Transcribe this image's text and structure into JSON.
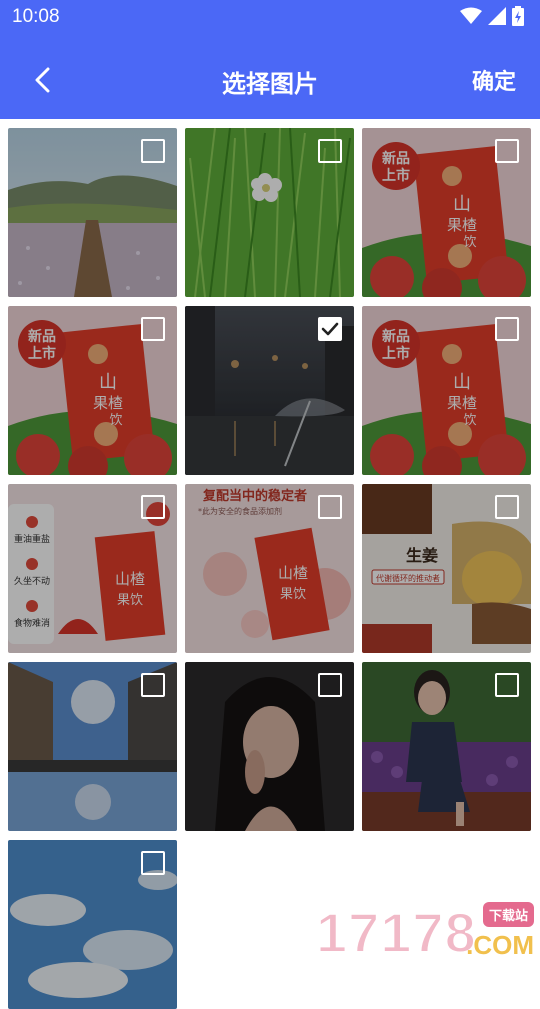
{
  "status_bar": {
    "time": "10:08"
  },
  "header": {
    "title": "选择图片",
    "confirm_label": "确定"
  },
  "photos": [
    {
      "subject": "landscape-flower-field",
      "checked": false
    },
    {
      "subject": "grass-with-white-flower",
      "checked": false
    },
    {
      "subject": "hawthorn-drink-ad",
      "badge": "新品\n上市",
      "product": "山楂果饮",
      "checked": false
    },
    {
      "subject": "hawthorn-drink-ad",
      "badge": "新品\n上市",
      "product": "山楂果饮",
      "checked": false
    },
    {
      "subject": "rainy-street-umbrella",
      "checked": true
    },
    {
      "subject": "hawthorn-drink-ad",
      "badge": "新品\n上市",
      "product": "山楂果饮",
      "checked": false
    },
    {
      "subject": "hawthorn-drink-features",
      "product": "山楂果饮",
      "features": [
        "重油重盐",
        "久坐不动",
        "食物难消"
      ],
      "checked": false
    },
    {
      "subject": "hawthorn-drink-bubbles",
      "headline": "复配当中的稳定者",
      "subline": "*此为安全的食品添加剂",
      "product": "山楂果饮",
      "checked": false
    },
    {
      "subject": "ginger-food-ad",
      "headline": "生姜",
      "subline": "代谢循环的推动者",
      "checked": false
    },
    {
      "subject": "street-reflection",
      "checked": false
    },
    {
      "subject": "woman-portrait-dark",
      "checked": false
    },
    {
      "subject": "woman-sitting-flowers",
      "checked": false
    },
    {
      "subject": "sky-clouds",
      "checked": false
    }
  ],
  "watermark": {
    "number": "17178",
    "tag": "下载站",
    "domain": ".COM"
  },
  "colors": {
    "header": "#4B68F6",
    "checkbox": "#ffffff"
  }
}
